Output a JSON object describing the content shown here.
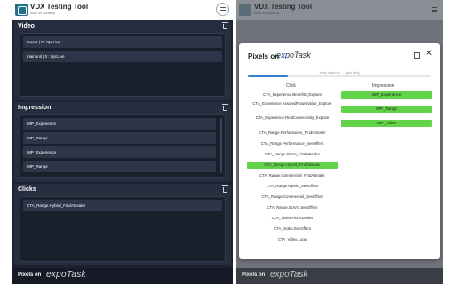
{
  "app": {
    "title": "VDX Testing Tool",
    "subtitle": "Built on NeatUp"
  },
  "sections": {
    "video": {
      "heading": "Video",
      "items": [
        "teaser | 0 : 0pcLive",
        "mainunit | 0 : 0pcLive"
      ]
    },
    "impression": {
      "heading": "Impression",
      "items": [
        "IMP_Experience",
        "IMP_Range",
        "IMP_Experience",
        "IMP_Range"
      ]
    },
    "clicks": {
      "heading": "Clicks",
      "items": [
        "CTA_Range.Hybrid_FindADealer"
      ]
    }
  },
  "footer": {
    "label": "Pixels on",
    "brand": "expoTask"
  },
  "modal": {
    "title": "Pixels on",
    "brand_prefix": "e",
    "brand_rest": "poTask",
    "brand_accent": "x",
    "progress_text": "verify based on … pixel firing",
    "progress_percent": 22,
    "columns": {
      "click": "Click",
      "impression": "Impression"
    },
    "clicks": [
      {
        "label": "CTA_Experience.Benefits_Explore",
        "highlight": false
      },
      {
        "label": "CTA_Experience.AssuredFutureValue_Explore",
        "highlight": false
      },
      {
        "label": "CTA_Experience.RealConnectivity_Explore",
        "highlight": false
      },
      {
        "label": "CTA_Range.Performance_FindADealer",
        "highlight": false
      },
      {
        "label": "CTA_Range.Performance_SeeOffers",
        "highlight": false
      },
      {
        "label": "CTA_Range.SUVs_FindADealer",
        "highlight": false
      },
      {
        "label": "CTA_Range.Hybrid_FindADealer",
        "highlight": true
      },
      {
        "label": "CTA_Range.Commercial_FindADealer",
        "highlight": false
      },
      {
        "label": "CTA_Range.Hybrid_SeeOffers",
        "highlight": false
      },
      {
        "label": "CTA_Range.Commercial_SeeOffers",
        "highlight": false
      },
      {
        "label": "CTA_Range.SUVs_SeeOffers",
        "highlight": false
      },
      {
        "label": "CTA_Video.FindADealer",
        "highlight": false
      },
      {
        "label": "CTA_Video.SeeOffers",
        "highlight": false
      },
      {
        "label": "CTA_Video.Logo",
        "highlight": false
      }
    ],
    "impressions": [
      "IMP_Experience",
      "IMP_Range",
      "IMP_Video"
    ]
  },
  "colors": {
    "panel_bg": "#1c2232",
    "section_bg": "#262d3f",
    "item_bg": "#2e3548",
    "highlight_green": "#62d44a",
    "accent_blue": "#3a7bd5"
  },
  "icons": [
    "menu-icon",
    "trash-icon",
    "open-external-icon",
    "close-icon",
    "app-logo-icon"
  ]
}
